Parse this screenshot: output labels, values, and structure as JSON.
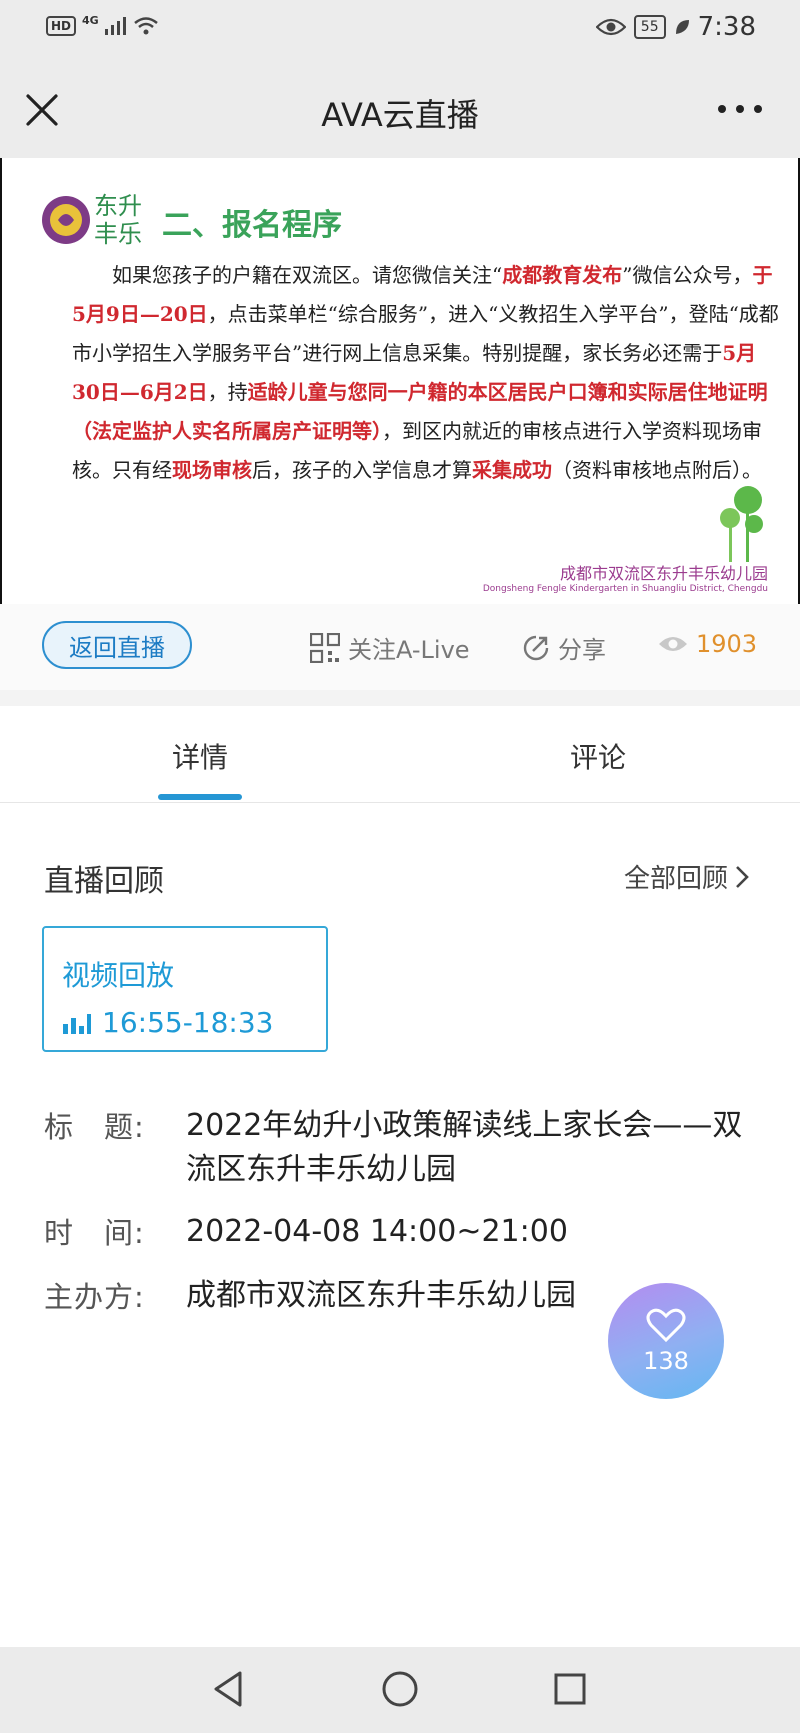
{
  "status_bar": {
    "hd": "HD",
    "network": "4G",
    "battery": "55",
    "time": "7:38"
  },
  "header": {
    "title": "AVA云直播"
  },
  "banner": {
    "logo_text_line1": "东升",
    "logo_text_line2": "丰乐",
    "heading": "二、报名程序",
    "body": {
      "p1_a": "如果您孩子的户籍在双流区。请您微信关注“",
      "p1_red1": "成都教育发布",
      "p1_b": "”微信公众号，",
      "p1_red2": "于5月9日—20日",
      "p1_c": "，点击菜单栏“综合服务”，进入“义教招生入学平台”，登陆“成都市小学招生入学服务平台”进行网上信息采集。特别提醒，家长务必还需于",
      "p1_red3": "5月30日—6月2日",
      "p1_d": "，持",
      "p1_red4": "适龄儿童与您同一户籍的本区居民户口簿和实际居住地证明（法定监护人实名所属房产证明等）",
      "p1_e": "，到区内就近的审核点进行入学资料现场审核。只有经",
      "p1_red5": "现场审核",
      "p1_f": "后，孩子的入学信息才算",
      "p1_red6": "采集成功",
      "p1_g": "（资料审核地点附后）。"
    },
    "brand_cn": "成都市双流区东升丰乐幼儿园",
    "brand_en": "Dongsheng Fengle Kindergarten in Shuangliu District, Chengdu"
  },
  "actions": {
    "back_live": "返回直播",
    "follow": "关注A-Live",
    "share": "分享",
    "views": "1903"
  },
  "tabs": [
    {
      "label": "详情"
    },
    {
      "label": "评论"
    }
  ],
  "review": {
    "title": "直播回顾",
    "all_link": "全部回顾",
    "card_label": "视频回放",
    "card_time": "16:55-18:33"
  },
  "info": {
    "title_label": "标　题:",
    "title_value": "2022年幼升小政策解读线上家长会——双流区东升丰乐幼儿园",
    "time_label": "时　间:",
    "time_value": "2022-04-08 14:00~21:00",
    "host_label": "主办方:",
    "host_value": "成都市双流区东升丰乐幼儿园"
  },
  "like": {
    "count": "138"
  },
  "colors": {
    "accent": "#2596d4",
    "highlight_red": "#d0282f",
    "views_orange": "#e0902c"
  },
  "icons": [
    "close-icon",
    "more-icon",
    "qrcode-icon",
    "share-icon",
    "eye-icon",
    "chevron-right-icon",
    "bar-chart-icon",
    "heart-icon",
    "nav-back-icon",
    "nav-home-icon",
    "nav-recent-icon"
  ]
}
